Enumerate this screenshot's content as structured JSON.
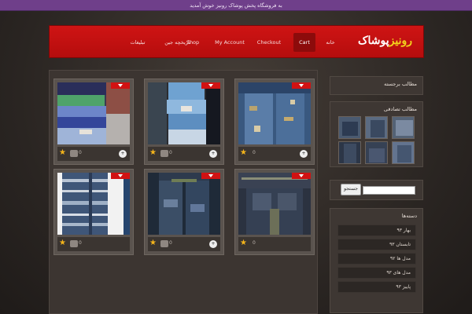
{
  "notice": "به فروشگاه پخش پوشاک رونیز خوش آمدید",
  "logo": {
    "part1": "پوشاک",
    "part2": "رونیز"
  },
  "nav": {
    "items": [
      {
        "label": "خانه"
      },
      {
        "label": "Cart"
      },
      {
        "label": "Checkout"
      },
      {
        "label": "My Account"
      },
      {
        "label": "Shop"
      },
      {
        "label": "تاریخچه جین"
      },
      {
        "label": "تبلیغات"
      }
    ],
    "active": "Cart"
  },
  "products": [
    {
      "image": "colorful-folded-jeans-stack",
      "comments": "0"
    },
    {
      "image": "light-blue-jeans-stack",
      "comments": "0"
    },
    {
      "image": "distressed-blue-jeans-closeup",
      "comments": "0"
    },
    {
      "image": "striped-distressed-jeans",
      "comments": "0"
    },
    {
      "image": "dark-wash-jeans-front",
      "comments": "0"
    },
    {
      "image": "dark-jeans-pocket-detail",
      "comments": "0"
    }
  ],
  "sidebar": {
    "featured_title": "مطالب برجسته",
    "random_title": "مطالب تصادفی",
    "search_button": "جستجو",
    "search_value": "",
    "categories_title": "دسته‌ها",
    "categories": [
      {
        "label": "بهار ۹۳"
      },
      {
        "label": "تابستان ۹۳"
      },
      {
        "label": "مدل ها ۹۲"
      },
      {
        "label": "مدل های ۹۳"
      },
      {
        "label": "پاییز ۹۳"
      }
    ]
  },
  "colors": {
    "accent": "#cf1414",
    "logo_highlight": "#f3d21c",
    "topbar": "#6f3f8a"
  }
}
